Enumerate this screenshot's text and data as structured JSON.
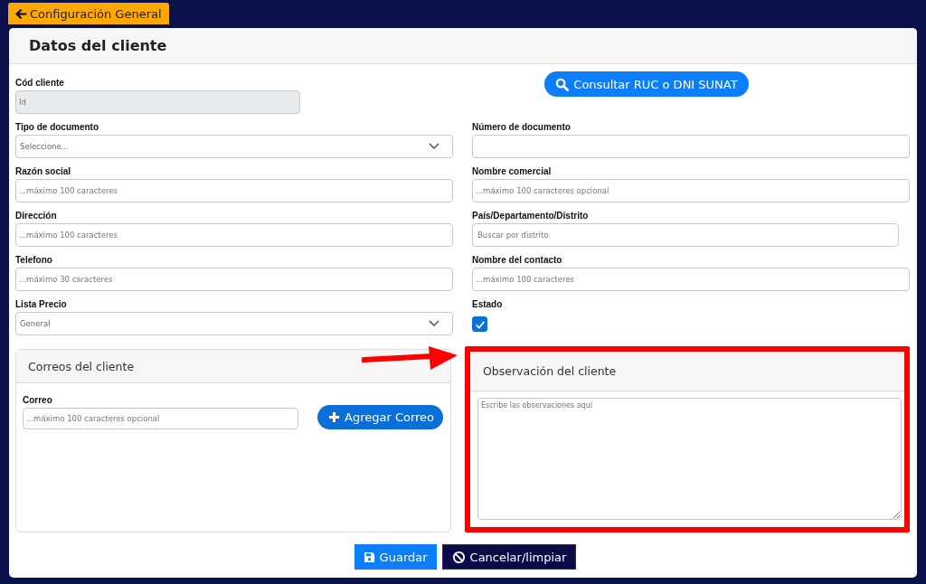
{
  "back_button": {
    "label": "Configuración General"
  },
  "card": {
    "title": "Datos del cliente",
    "rows": [
      {
        "left": {
          "kind": "input",
          "label": "Cód cliente",
          "placeholder": "Id",
          "disabled": true
        },
        "right": {
          "kind": "button",
          "label": "Consultar RUC o DNI SUNAT"
        }
      },
      {
        "left": {
          "kind": "select",
          "label": "Tipo de documento",
          "value": "Seleccione..."
        },
        "right": {
          "kind": "input",
          "label": "Número de documento",
          "disabled": false
        }
      },
      {
        "left": {
          "kind": "input",
          "label": "Razón social",
          "placeholder": "...máximo 100 caracteres",
          "disabled": false
        },
        "right": {
          "kind": "input",
          "label": "Nombre comercial",
          "placeholder": "...máximo 100 caracteres opcional",
          "disabled": false
        }
      },
      {
        "left": {
          "kind": "input",
          "label": "Dirección",
          "placeholder": "...máximo 100 caracteres",
          "disabled": false
        },
        "right": {
          "kind": "search",
          "label": "País/Departamento/Distrito",
          "placeholder": "Buscar por distrito"
        }
      },
      {
        "left": {
          "kind": "input",
          "label": "Telefono",
          "placeholder": "...máximo 30 caracteres",
          "disabled": false
        },
        "right": {
          "kind": "input",
          "label": "Nombre del contacto",
          "placeholder": "...máximo 100 caracteres",
          "disabled": false
        }
      },
      {
        "left": {
          "kind": "select",
          "label": "Lista Precio",
          "value": "General"
        },
        "right": {
          "kind": "checkbox",
          "label": "Estado",
          "checked": true
        }
      }
    ],
    "emails_panel": {
      "title": "Correos del cliente",
      "label": "Correo",
      "placeholder": "...máximo 100 caracteres opcional",
      "add_button": "Agregar Correo"
    },
    "observations_panel": {
      "title": "Observación del cliente",
      "placeholder": "Escribe las observaciones aquí",
      "highlighted": true
    },
    "footer_buttons": [
      {
        "kind": "save",
        "label": "Guardar"
      },
      {
        "kind": "cancel",
        "label": "Cancelar/limpiar"
      }
    ]
  }
}
